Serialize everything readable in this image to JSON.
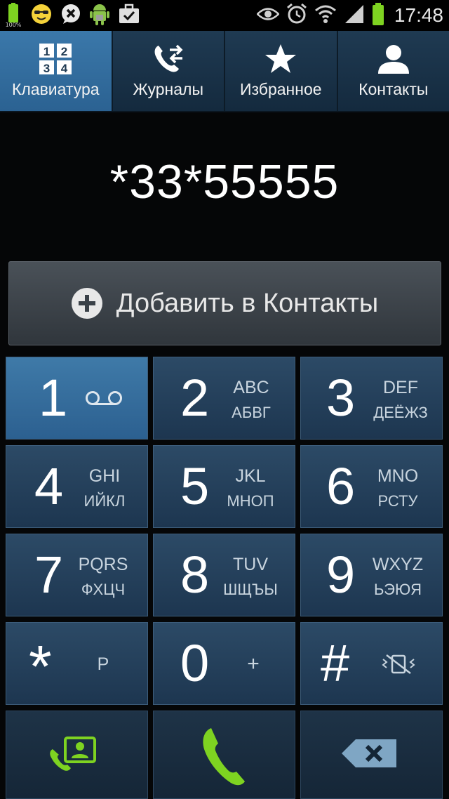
{
  "status_bar": {
    "battery_small_label": "100%",
    "time": "17:48",
    "left_icons": [
      "battery-100-icon",
      "sunglasses-smiley-icon",
      "chat-x-icon",
      "android-icon",
      "briefcase-check-icon"
    ],
    "right_icons": [
      "eye-icon",
      "alarm-icon",
      "wifi-icon",
      "signal-icon",
      "battery-icon"
    ]
  },
  "tabs": [
    {
      "label": "Клавиатура",
      "icon": "keypad-icon",
      "active": true
    },
    {
      "label": "Журналы",
      "icon": "call-log-icon",
      "active": false
    },
    {
      "label": "Избранное",
      "icon": "star-icon",
      "active": false
    },
    {
      "label": "Контакты",
      "icon": "person-icon",
      "active": false
    }
  ],
  "keypad_icon_digits": [
    "1",
    "2",
    "3",
    "4"
  ],
  "dialed_number": "*33*55555",
  "add_to_contacts_label": "Добавить в Контакты",
  "keys": [
    {
      "digit": "1",
      "latin": "",
      "cyrillic": "",
      "icon": "voicemail-icon"
    },
    {
      "digit": "2",
      "latin": "ABC",
      "cyrillic": "АБВГ"
    },
    {
      "digit": "3",
      "latin": "DEF",
      "cyrillic": "ДЕЁЖЗ"
    },
    {
      "digit": "4",
      "latin": "GHI",
      "cyrillic": "ИЙКЛ"
    },
    {
      "digit": "5",
      "latin": "JKL",
      "cyrillic": "МНОП"
    },
    {
      "digit": "6",
      "latin": "MNO",
      "cyrillic": "РСТУ"
    },
    {
      "digit": "7",
      "latin": "PQRS",
      "cyrillic": "ФХЦЧ"
    },
    {
      "digit": "8",
      "latin": "TUV",
      "cyrillic": "ШЩЪЫ"
    },
    {
      "digit": "9",
      "latin": "WXYZ",
      "cyrillic": "ЬЭЮЯ"
    },
    {
      "digit": "*",
      "sub": "P"
    },
    {
      "digit": "0",
      "sub": "+"
    },
    {
      "digit": "#",
      "icon": "vibrate-off-icon"
    }
  ],
  "bottom_row": {
    "left_icon": "contacts-call-icon",
    "center_icon": "phone-call-icon",
    "right_icon": "backspace-icon"
  },
  "colors": {
    "accent_green": "#7ed321",
    "key_blue": "#2c4a66",
    "active_tab": "#3b78aa"
  }
}
